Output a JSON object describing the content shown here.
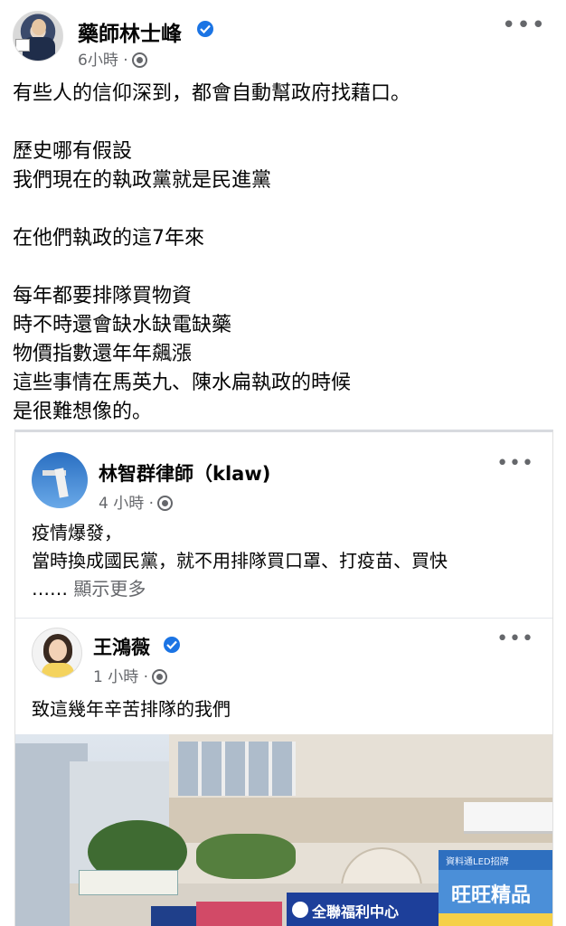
{
  "post": {
    "author": "藥師林士峰",
    "time": "6小時 ·",
    "more": "•••",
    "lines": [
      "有些人的信仰深到，都會自動幫政府找藉口。",
      "",
      "歷史哪有假設",
      "我們現在的執政黨就是民進黨",
      "",
      "在他們執政的這7年來",
      "",
      "每年都要排隊買物資",
      "時不時還會缺水缺電缺藥",
      "物價指數還年年飆漲",
      "這些事情在馬英九、陳水扁執政的時候",
      "是很難想像的。"
    ]
  },
  "shared": {
    "author": "林智群律師（klaw)",
    "time": "4 小時 ·",
    "more": "•••",
    "line1": "疫情爆發，",
    "line2": "當時換成國民黨，就不用排隊買口罩、打疫苗、買快",
    "ellipsis": "……",
    "see_more": "顯示更多",
    "inner": {
      "author": "王鴻薇",
      "time": "1 小時 ·",
      "more": "•••",
      "text": "致這幾年辛苦排隊的我們",
      "photo_signs": {
        "blue_sign": "全聯福利中心",
        "right_sign": "旺旺精品",
        "right_band": "資料通LED招牌"
      }
    }
  },
  "colors": {
    "verified_badge": "#1b74e4",
    "meta_text": "#65676b",
    "text": "#050505"
  },
  "icons": {
    "verified": "verified-badge-icon",
    "audience": "globe-icon",
    "more": "more-options-icon"
  }
}
